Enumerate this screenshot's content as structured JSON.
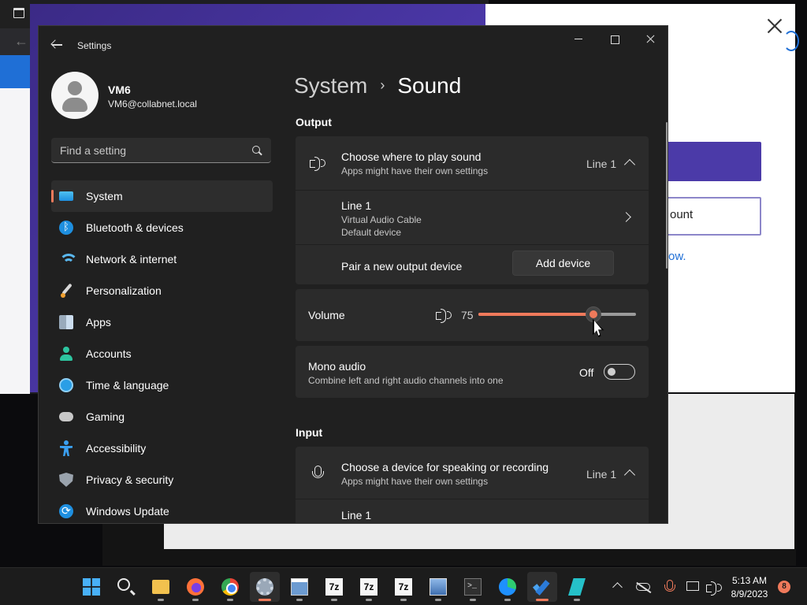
{
  "background": {
    "account_button_label": "ount",
    "link_text": "ow."
  },
  "window": {
    "title": "Settings"
  },
  "profile": {
    "name": "VM6",
    "email": "VM6@collabnet.local"
  },
  "search": {
    "placeholder": "Find a setting"
  },
  "sidebar": {
    "items": [
      {
        "label": "System",
        "icon": "system-icon",
        "selected": true
      },
      {
        "label": "Bluetooth & devices",
        "icon": "bluetooth-icon"
      },
      {
        "label": "Network & internet",
        "icon": "wifi-icon"
      },
      {
        "label": "Personalization",
        "icon": "brush-icon"
      },
      {
        "label": "Apps",
        "icon": "apps-icon"
      },
      {
        "label": "Accounts",
        "icon": "person-icon"
      },
      {
        "label": "Time & language",
        "icon": "globe-clock-icon"
      },
      {
        "label": "Gaming",
        "icon": "gamepad-icon"
      },
      {
        "label": "Accessibility",
        "icon": "accessibility-icon"
      },
      {
        "label": "Privacy & security",
        "icon": "shield-icon"
      },
      {
        "label": "Windows Update",
        "icon": "update-icon"
      }
    ]
  },
  "breadcrumb": {
    "parent": "System",
    "separator": "›",
    "current": "Sound"
  },
  "output": {
    "section_label": "Output",
    "choose_title": "Choose where to play sound",
    "choose_subtitle": "Apps might have their own settings",
    "choose_value": "Line 1",
    "device_name": "Line 1",
    "device_desc": "Virtual Audio Cable",
    "device_status": "Default device",
    "pair_label": "Pair a new output device",
    "add_device_button": "Add device"
  },
  "volume": {
    "label": "Volume",
    "value": "75",
    "level": 0.73
  },
  "mono": {
    "title": "Mono audio",
    "subtitle": "Combine left and right audio channels into one",
    "state": "Off"
  },
  "input": {
    "section_label": "Input",
    "choose_title": "Choose a device for speaking or recording",
    "choose_subtitle": "Apps might have their own settings",
    "choose_value": "Line 1",
    "device_name": "Line 1"
  },
  "taskbar": {
    "apps": [
      "start",
      "search",
      "file-explorer",
      "firefox",
      "chrome",
      "settings",
      "resource-monitor",
      "7zip",
      "7zip",
      "7zip",
      "remote-desktop",
      "terminal",
      "edge",
      "todo",
      "teal-app"
    ],
    "active_app": "settings",
    "seven_zip_label": "7z",
    "terminal_label": ">_",
    "time": "5:13 AM",
    "date": "8/9/2023",
    "notification_count": "8"
  },
  "colors": {
    "accent": "#f07a5b",
    "window_bg": "#202020",
    "card_bg": "#2b2b2b"
  }
}
